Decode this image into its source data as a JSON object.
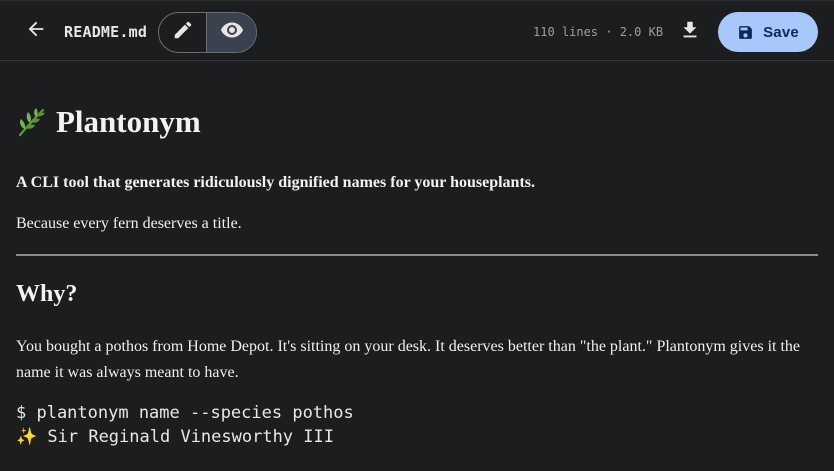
{
  "toolbar": {
    "filename": "README.md",
    "meta": "110 lines · 2.0 KB",
    "save_label": "Save",
    "icons": {
      "back": "arrow-left-icon",
      "edit": "pencil-icon",
      "preview": "eye-icon",
      "download": "download-icon",
      "save": "floppy-disk-icon"
    },
    "colors": {
      "save_bg": "#a8c7fa",
      "save_text": "#0b2b57",
      "preview_active_bg": "#3a4250"
    }
  },
  "document": {
    "title_emoji": "🌿",
    "title": "Plantonym",
    "tagline": "A CLI tool that generates ridiculously dignified names for your houseplants.",
    "subtitle": "Because every fern deserves a title.",
    "section_heading": "Why?",
    "paragraph": "You bought a pothos from Home Depot. It's sitting on your desk. It deserves better than \"the plant.\" Plantonym gives it the name it was always meant to have.",
    "code_lines": [
      "$ plantonym name --species pothos",
      "✨ Sir Reginald Vinesworthy III"
    ]
  }
}
